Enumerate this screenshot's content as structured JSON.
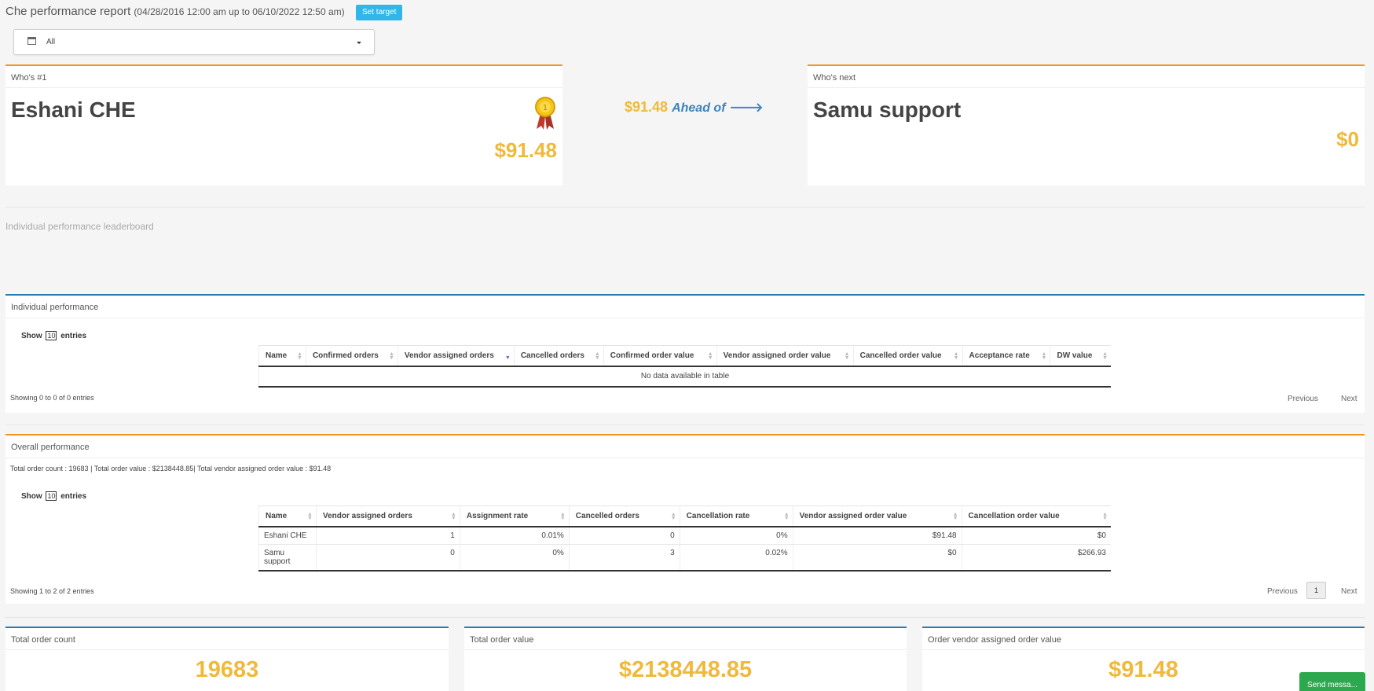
{
  "header": {
    "title": "Che performance report",
    "range": "(04/28/2016 12:00 am up to 06/10/2022 12:50 am)",
    "set_target_label": "Set target",
    "range_select_value": "All"
  },
  "who_first": {
    "heading": "Who's #1",
    "name": "Eshani CHE",
    "amount": "$91.48"
  },
  "ahead": {
    "amount": "$91.48",
    "label": "Ahead of",
    "arrow": "🡒"
  },
  "who_next": {
    "heading": "Who's next",
    "name": "Samu support",
    "amount": "$0"
  },
  "leaderboard_title": "Individual performance leaderboard",
  "individual": {
    "title": "Individual performance",
    "show_label": "Show",
    "show_value": "10",
    "entries_label": "entries",
    "columns": [
      "Name",
      "Confirmed orders",
      "Vendor assigned orders",
      "Cancelled orders",
      "Confirmed order value",
      "Vendor assigned order value",
      "Cancelled order value",
      "Acceptance rate",
      "DW value"
    ],
    "empty_text": "No data available in table",
    "info": "Showing 0 to 0 of 0 entries",
    "previous": "Previous",
    "next": "Next"
  },
  "overall": {
    "title": "Overall performance",
    "totals_line": "Total order count : 19683 | Total order value : $2138448.85| Total vendor assigned order value : $91.48",
    "show_label": "Show",
    "show_value": "10",
    "entries_label": "entries",
    "columns": [
      "Name",
      "Vendor assigned orders",
      "Assignment rate",
      "Cancelled orders",
      "Cancellation rate",
      "Vendor assigned order value",
      "Cancellation order value"
    ],
    "rows": [
      [
        "Eshani CHE",
        "1",
        "0.01%",
        "0",
        "0%",
        "$91.48",
        "$0"
      ],
      [
        "Samu support",
        "0",
        "0%",
        "3",
        "0.02%",
        "$0",
        "$266.93"
      ]
    ],
    "info": "Showing 1 to 2 of 2 entries",
    "previous": "Previous",
    "current_page": "1",
    "next": "Next"
  },
  "stats": [
    {
      "title": "Total order count",
      "value": "19683"
    },
    {
      "title": "Total order value",
      "value": "$2138448.85"
    },
    {
      "title": "Order vendor assigned order value",
      "value": "$91.48"
    }
  ],
  "send_message_label": "Send messa...",
  "colors": {
    "accent_orange": "#f7941d",
    "accent_blue": "#2a7ab0",
    "amount_yellow": "#f0b93a",
    "button_blue": "#31b6ea",
    "send_green": "#2ea84f"
  }
}
